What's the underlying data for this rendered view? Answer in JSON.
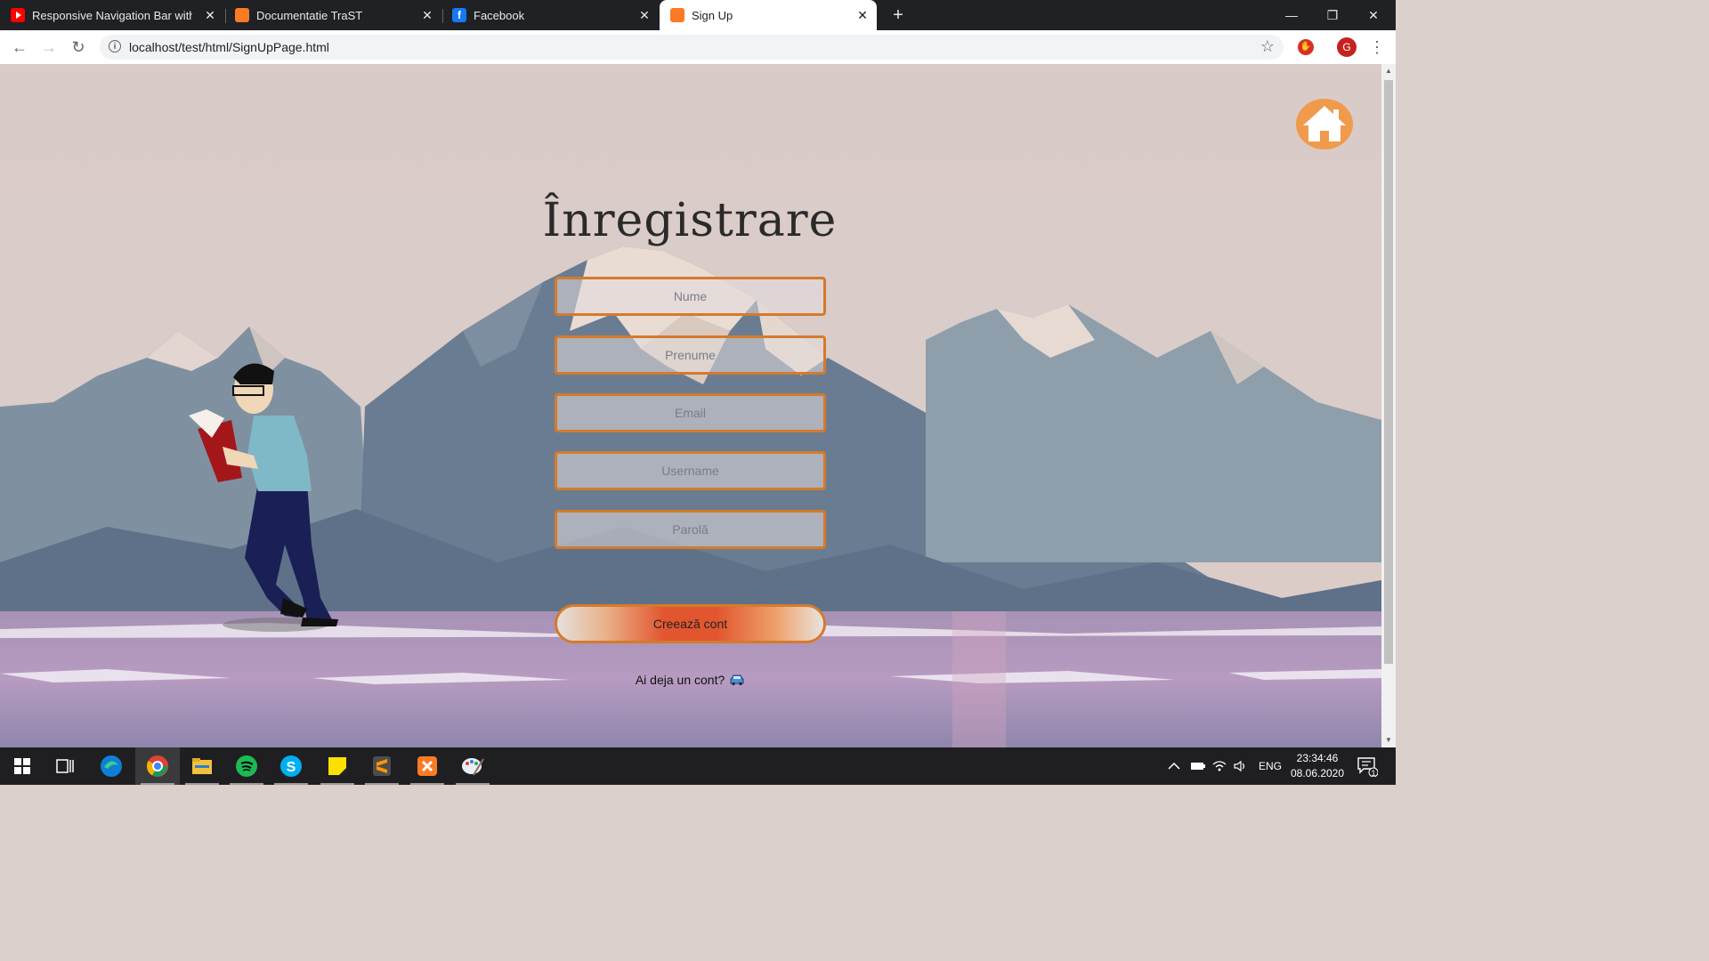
{
  "browser": {
    "tabs": [
      {
        "title": "Responsive Navigation Bar with H",
        "favicon": "youtube-icon",
        "active": false
      },
      {
        "title": "Documentatie TraST",
        "favicon": "xampp-icon",
        "active": false
      },
      {
        "title": "Facebook",
        "favicon": "facebook-icon",
        "active": false
      },
      {
        "title": "Sign Up",
        "favicon": "xampp-icon",
        "active": true
      }
    ],
    "new_tab": "+",
    "url": "localhost/test/html/SignUpPage.html",
    "profile_initial": "G",
    "window_controls": {
      "minimize": "—",
      "restore": "❐",
      "close": "✕"
    }
  },
  "page": {
    "title": "Înregistrare",
    "fields": {
      "nume": "Nume",
      "prenume": "Prenume",
      "email": "Email",
      "username": "Username",
      "parola": "Parolă"
    },
    "submit_label": "Creează cont",
    "login_prompt": "Ai deja un cont?"
  },
  "taskbar": {
    "apps": [
      "start-icon",
      "task-view-icon",
      "edge-icon",
      "chrome-icon",
      "file-explorer-icon",
      "spotify-icon",
      "skype-icon",
      "sticky-notes-icon",
      "sublime-text-icon",
      "xampp-icon",
      "paint-icon"
    ],
    "language": "ENG",
    "time": "23:34:46",
    "date": "08.06.2020",
    "notifications": "1"
  },
  "colors": {
    "accent_orange": "#d57a2c",
    "home_button": "#f09a4c",
    "background": "#dccdc9"
  }
}
